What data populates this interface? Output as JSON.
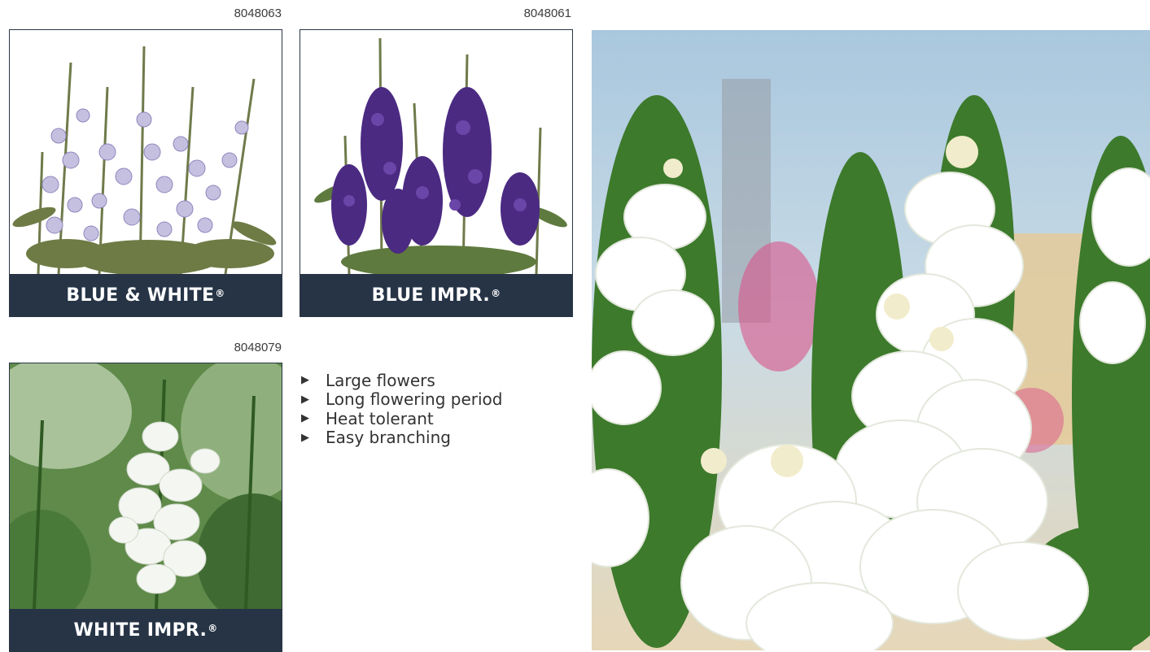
{
  "products": [
    {
      "code": "8048063",
      "name": "BLUE & WHITE",
      "mark": "®"
    },
    {
      "code": "8048061",
      "name": "BLUE IMPR.",
      "mark": "®"
    },
    {
      "code": "8048079",
      "name": "WHITE IMPR.",
      "mark": "®"
    }
  ],
  "features": [
    "Large flowers",
    "Long flowering period",
    "Heat tolerant",
    "Easy branching"
  ],
  "icons": {
    "bullet": "triangle-right"
  },
  "colors": {
    "label_bg": "#263446",
    "label_text": "#ffffff",
    "purple": "#4b2a82",
    "lavender": "#b8b3d6"
  }
}
